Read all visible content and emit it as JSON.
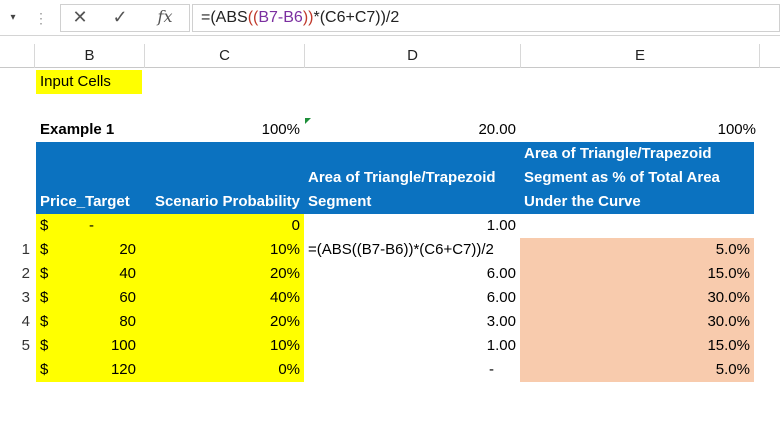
{
  "formula_bar": {
    "namebox_arrow": "▾",
    "separator": "⋮",
    "cancel": "✕",
    "enter": "✓",
    "fx": "fx",
    "formula_parts": [
      "=(ABS",
      "((",
      "B7-B6",
      "))",
      "*(C6+C7))/2"
    ]
  },
  "columns": [
    "B",
    "C",
    "D",
    "E"
  ],
  "input_cells_label": "Input Cells",
  "example": {
    "label": "Example 1",
    "c_total": "100%",
    "d_total": "20.00",
    "e_total": "100%"
  },
  "table_header": {
    "b": "Price_Target",
    "c": "Scenario Probability",
    "d_line1": "Area of Triangle/Trapezoid",
    "d_line2": "Segment",
    "e_line1": "Area of Triangle/Trapezoid",
    "e_line2": "Segment as % of Total Area",
    "e_line3": "Under the Curve"
  },
  "rows": [
    {
      "num": "",
      "cur": "$",
      "price": "-",
      "prob": "0",
      "area": "1.00",
      "pct": ""
    },
    {
      "num": "1",
      "cur": "$",
      "price": "20",
      "prob": "10%",
      "area": "=(ABS((B7-B6))*(C6+C7))/2",
      "pct": "5.0%"
    },
    {
      "num": "2",
      "cur": "$",
      "price": "40",
      "prob": "20%",
      "area": "6.00",
      "pct": "15.0%"
    },
    {
      "num": "3",
      "cur": "$",
      "price": "60",
      "prob": "40%",
      "area": "6.00",
      "pct": "30.0%"
    },
    {
      "num": "4",
      "cur": "$",
      "price": "80",
      "prob": "20%",
      "area": "3.00",
      "pct": "30.0%"
    },
    {
      "num": "5",
      "cur": "$",
      "price": "100",
      "prob": "10%",
      "area": "1.00",
      "pct": "15.0%"
    },
    {
      "num": "",
      "cur": "$",
      "price": "120",
      "prob": "0%",
      "area": "-",
      "pct": "5.0%"
    }
  ],
  "colors": {
    "header_blue": "#0b72c0",
    "input_yellow": "#ffff00",
    "output_peach": "#f8cbad"
  }
}
